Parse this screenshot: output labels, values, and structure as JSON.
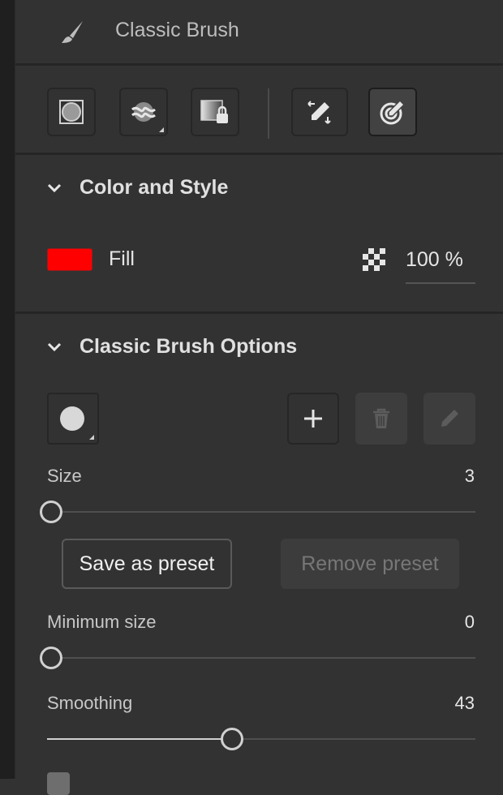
{
  "header": {
    "title": "Classic Brush",
    "icon": "paintbrush-icon"
  },
  "toolbar": {
    "buttons": [
      {
        "name": "brush-shape-button",
        "icon": "circle-square-icon",
        "active": false
      },
      {
        "name": "stroke-blend-button",
        "icon": "blend-stroke-icon",
        "active": false
      },
      {
        "name": "lock-transparency-button",
        "icon": "gradient-lock-icon",
        "active": false
      },
      {
        "name": "pressure-pen-button",
        "icon": "pen-arrows-icon",
        "active": false
      },
      {
        "name": "target-pen-button",
        "icon": "target-pen-icon",
        "active": true
      }
    ]
  },
  "color_style": {
    "title": "Color and Style",
    "fill_label": "Fill",
    "fill_color": "#ff0000",
    "opacity_value": "100 %",
    "opacity_icon": "checkerboard-icon"
  },
  "brush_options": {
    "title": "Classic Brush Options",
    "preset_icon": "circle-brush-icon",
    "add_icon": "plus-icon",
    "delete_icon": "trash-icon",
    "edit_icon": "pencil-icon",
    "size": {
      "label": "Size",
      "value": "3",
      "fraction": 0.0
    },
    "save_preset_label": "Save as preset",
    "remove_preset_label": "Remove preset",
    "min_size": {
      "label": "Minimum size",
      "value": "0",
      "fraction": 0.0
    },
    "smoothing": {
      "label": "Smoothing",
      "value": "43",
      "fraction": 0.43
    }
  }
}
